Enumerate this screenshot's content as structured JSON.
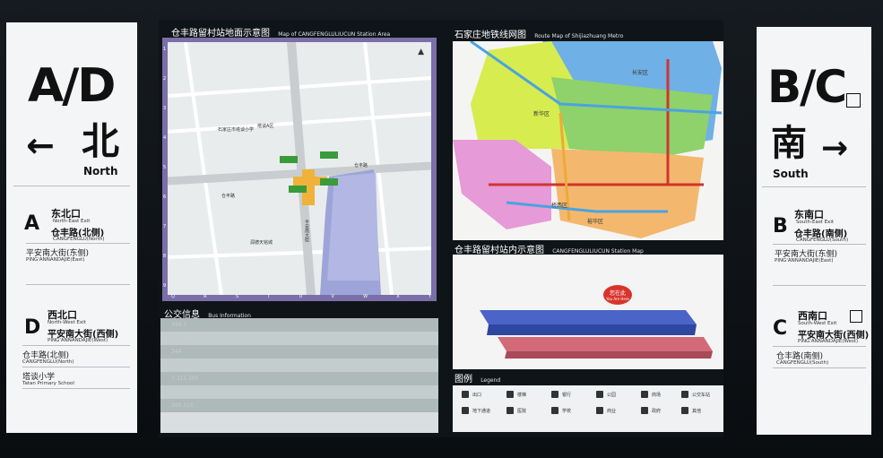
{
  "left_sign": {
    "code": "A/D",
    "arrow": "←",
    "direction_cn": "北",
    "direction_en": "North",
    "exits": [
      {
        "letter": "A",
        "name_cn": "东北口",
        "name_en": "North-East Exit",
        "road_cn": "仓丰路(北侧)",
        "road_en": "CANGFENGLU(North)",
        "sub_cn": "平安南大街(东侧)",
        "sub_en": "PING'ANNANDAJIE(East)"
      },
      {
        "letter": "D",
        "name_cn": "西北口",
        "name_en": "North-West Exit",
        "road_cn": "平安南大街(西侧)",
        "road_en": "PING'ANNANDAJIE(West)",
        "sub_cn": "仓丰路(北侧)",
        "sub_en": "CANGFENGLU(North)",
        "sub2_cn": "塔谈小学",
        "sub2_en": "Tatan Primary School"
      }
    ]
  },
  "right_sign": {
    "code": "B/C",
    "arrow": "→",
    "direction_cn": "南",
    "direction_en": "South",
    "exits": [
      {
        "letter": "B",
        "name_cn": "东南口",
        "name_en": "South-East Exit",
        "road_cn": "仓丰路(南侧)",
        "road_en": "CANGFENGLU(South)",
        "sub_cn": "平安南大街(东侧)",
        "sub_en": "PING'ANNANDAJIE(East)"
      },
      {
        "letter": "C",
        "name_cn": "西南口",
        "name_en": "South-West Exit",
        "road_cn": "平安南大街(西侧)",
        "road_en": "PING'ANNANDAJIE(West)",
        "sub_cn": "仓丰路(南侧)",
        "sub_en": "CANGFENGLU(South)"
      }
    ]
  },
  "area_map": {
    "title_cn": "仓丰路留村站地面示意图",
    "title_en": "Map of CANGFENGLULIUCUN Station Area",
    "labels": [
      "石家庄市塔谈小学",
      "塔谈A区",
      "仓丰路",
      "平安南大街",
      "仓丰路",
      "润德天铭城"
    ],
    "col_ticks": [
      "Q",
      "R",
      "S",
      "T",
      "U",
      "V",
      "W",
      "X",
      "Y"
    ],
    "row_ticks": [
      "1",
      "2",
      "3",
      "4",
      "5",
      "6",
      "7",
      "8",
      "9"
    ]
  },
  "route_map": {
    "title_cn": "石家庄地铁线网图",
    "title_en": "Route Map of Shijiazhuang Metro",
    "districts": [
      "新华区",
      "长安区",
      "桥西区",
      "裕华区"
    ],
    "colors": {
      "north": "#6fb0e6",
      "west": "#d7ec4e",
      "center": "#8fd16a",
      "south": "#f3b86e",
      "pink": "#e69ad7",
      "line1": "#d0352f",
      "line2": "#f0a83a",
      "line3": "#4aa3e0"
    }
  },
  "station_map": {
    "title_cn": "仓丰路留村站内示意图",
    "title_en": "CANGFENGLULIUCUN Station Map",
    "you_are_here_cn": "您在此",
    "you_are_here_en": "You Are Here"
  },
  "bus": {
    "title_cn": "公交信息",
    "title_en": "Bus Information",
    "rows": [
      "344  7",
      "315  205",
      "344",
      "344",
      "7  315  205",
      "7",
      "205  315"
    ]
  },
  "legend": {
    "title_cn": "图例",
    "title_en": "Legend",
    "items": [
      "出口",
      "楼梯",
      "银行",
      "公园",
      "商场",
      "公交车站",
      "地下通道",
      "医院",
      "学校",
      "商业",
      "政府",
      "其他"
    ]
  }
}
